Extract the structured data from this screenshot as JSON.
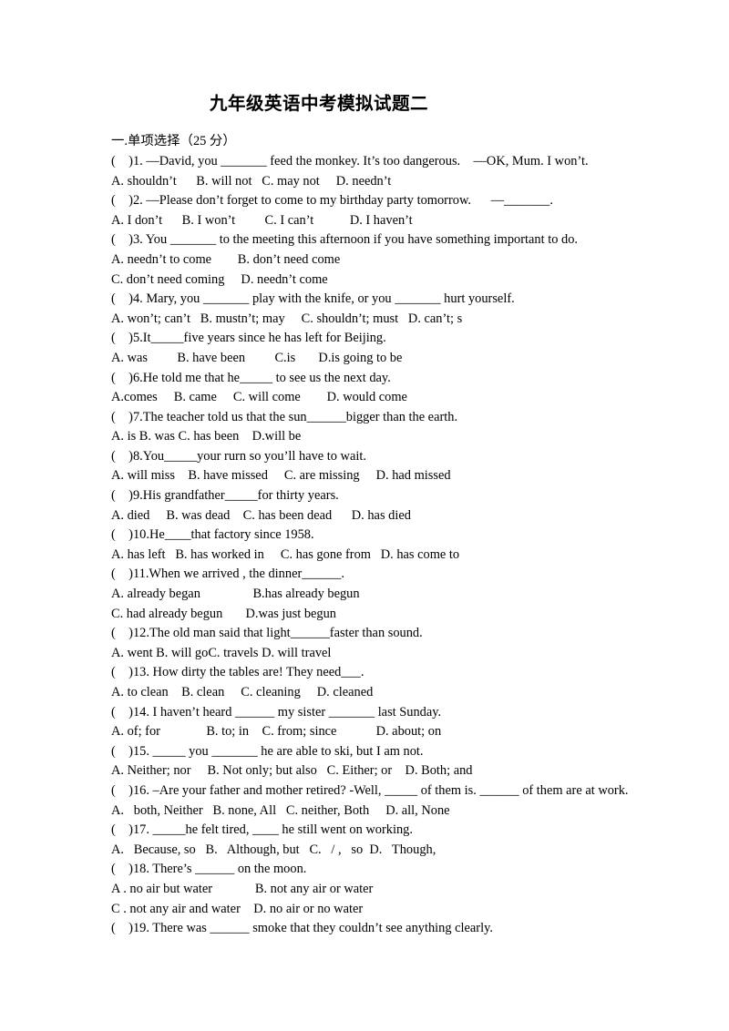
{
  "document": {
    "title": "九年级英语中考模拟试题二",
    "section_heading": "一.单项选择（25 分）",
    "lines": [
      {
        "kind": "question",
        "text": "(    )1. —David, you _______ feed the monkey. It’s too dangerous.    —OK, Mum. I won’t."
      },
      {
        "kind": "options",
        "text": "A. shouldn’t      B. will not   C. may not     D. needn’t"
      },
      {
        "kind": "question",
        "text": "(    )2. —Please don’t forget to come to my birthday party tomorrow.      —_______."
      },
      {
        "kind": "options",
        "text": "A. I don’t      B. I won’t         C. I can’t           D. I haven’t"
      },
      {
        "kind": "question",
        "text": "(    )3. You _______ to the meeting this afternoon if you have something important to do."
      },
      {
        "kind": "options",
        "text": "A. needn’t to come        B. don’t need come"
      },
      {
        "kind": "options",
        "text": "C. don’t need coming     D. needn’t come"
      },
      {
        "kind": "question",
        "text": "(    )4. Mary, you _______ play with the knife, or you _______ hurt yourself."
      },
      {
        "kind": "options",
        "text": "A. won’t; can’t   B. mustn’t; may     C. shouldn’t; must   D. can’t; s"
      },
      {
        "kind": "question",
        "text": "(    )5.It_____five years since he has left for Beijing."
      },
      {
        "kind": "options",
        "text": "A. was         B. have been         C.is       D.is going to be"
      },
      {
        "kind": "question",
        "text": "(    )6.He told me that he_____ to see us the next day."
      },
      {
        "kind": "options",
        "text": "A.comes     B. came     C. will come        D. would come"
      },
      {
        "kind": "question",
        "text": "(    )7.The teacher told us that the sun______bigger than the earth."
      },
      {
        "kind": "options",
        "text": "A. is B. was C. has been    D.will be"
      },
      {
        "kind": "question",
        "text": "(    )8.You_____your rurn so you’ll have to wait."
      },
      {
        "kind": "options",
        "text": "A. will miss    B. have missed     C. are missing     D. had missed"
      },
      {
        "kind": "question",
        "text": "(    )9.His grandfather_____for thirty years."
      },
      {
        "kind": "options",
        "text": "A. died     B. was dead    C. has been dead      D. has died"
      },
      {
        "kind": "question",
        "text": "(    )10.He____that factory since 1958."
      },
      {
        "kind": "options",
        "text": "A. has left   B. has worked in     C. has gone from   D. has come to"
      },
      {
        "kind": "question",
        "text": "(    )11.When we arrived , the dinner______."
      },
      {
        "kind": "options",
        "text": "A. already began                B.has already begun"
      },
      {
        "kind": "options",
        "text": "C. had already begun       D.was just begun"
      },
      {
        "kind": "question",
        "text": "(    )12.The old man said that light______faster than sound."
      },
      {
        "kind": "options",
        "text": "A. went B. will goC. travels D. will travel"
      },
      {
        "kind": "question",
        "text": "(    )13. How dirty the tables are! They need___."
      },
      {
        "kind": "options",
        "text": "A. to clean    B. clean     C. cleaning     D. cleaned"
      },
      {
        "kind": "question",
        "text": "(    )14. I haven’t heard ______ my sister _______ last Sunday."
      },
      {
        "kind": "options",
        "text": "A. of; for              B. to; in    C. from; since            D. about; on"
      },
      {
        "kind": "question",
        "text": "(    )15. _____ you _______ he are able to ski, but I am not."
      },
      {
        "kind": "options",
        "text": "A. Neither; nor     B. Not only; but also   C. Either; or    D. Both; and"
      },
      {
        "kind": "question",
        "text": "(    )16. –Are your father and mother retired? -Well, _____ of them is. ______ of them are at work."
      },
      {
        "kind": "options",
        "text": "A.   both, Neither   B. none, All   C. neither, Both     D. all, None"
      },
      {
        "kind": "question",
        "text": "(    )17. _____he felt tired, ____ he still went on working."
      },
      {
        "kind": "options",
        "text": "A.   Because, so   B.   Although, but   C.   / ,   so  D.   Though,"
      },
      {
        "kind": "question",
        "text": "(    )18. There’s ______ on the moon."
      },
      {
        "kind": "options",
        "text": "A . no air but water             B. not any air or water"
      },
      {
        "kind": "options",
        "text": "C . not any air and water    D. no air or no water"
      },
      {
        "kind": "question",
        "text": "(    )19. There was ______ smoke that they couldn’t see anything clearly."
      }
    ]
  }
}
